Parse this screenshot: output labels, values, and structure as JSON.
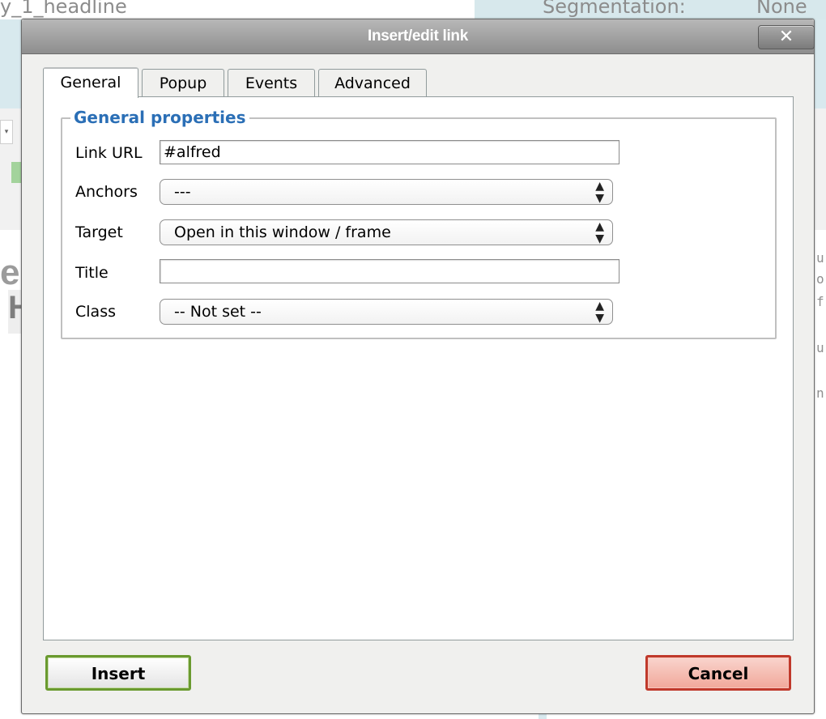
{
  "background": {
    "left_text": "y_1_headline",
    "right_label": "Segmentation:",
    "right_value": "None",
    "toolbar_dropdown": "▾",
    "big_fragment": "e",
    "big_fragment2": "H",
    "code_lines": [
      "u",
      "o",
      "f",
      "u",
      "n"
    ]
  },
  "dialog": {
    "title": "Insert/edit link",
    "close_symbol": "✕",
    "tabs": [
      {
        "label": "General"
      },
      {
        "label": "Popup"
      },
      {
        "label": "Events"
      },
      {
        "label": "Advanced"
      }
    ],
    "fieldset_legend": "General properties",
    "fields": {
      "link_url_label": "Link URL",
      "link_url_value": "#alfred",
      "anchors_label": "Anchors",
      "anchors_value": "---",
      "target_label": "Target",
      "target_value": "Open in this window / frame",
      "title_label": "Title",
      "title_value": "",
      "class_label": "Class",
      "class_value": "-- Not set --"
    },
    "buttons": {
      "insert": "Insert",
      "cancel": "Cancel"
    },
    "select_arrows": "▲▼"
  },
  "colors": {
    "legend": "#2b6fb6",
    "insert_border": "#6a9a2f",
    "cancel_border": "#c0392b",
    "titlebar": "#9e9e9e"
  }
}
